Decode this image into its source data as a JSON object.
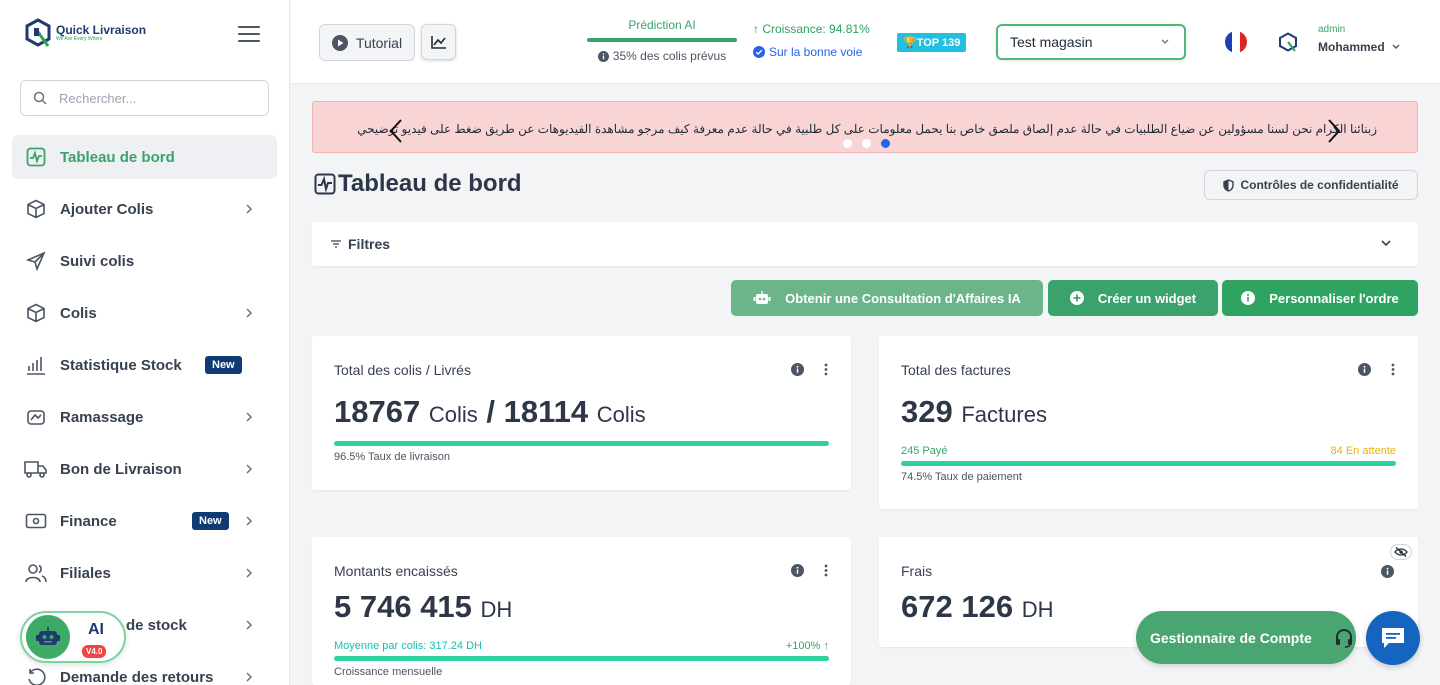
{
  "sidebar": {
    "logo": {
      "name": "Quick Livraison",
      "tagline": "We Are Every Where"
    },
    "search_placeholder": "Rechercher...",
    "items": [
      {
        "label": "Tableau de bord"
      },
      {
        "label": "Ajouter Colis"
      },
      {
        "label": "Suivi colis"
      },
      {
        "label": "Colis"
      },
      {
        "label": "Statistique Stock",
        "badge": "New"
      },
      {
        "label": "Ramassage"
      },
      {
        "label": "Bon de Livraison"
      },
      {
        "label": "Finance",
        "badge": "New"
      },
      {
        "label": "Filiales"
      },
      {
        "label": "de stock"
      },
      {
        "label": "Demande des retours"
      }
    ],
    "ai": {
      "label": "AI",
      "version": "V4.0"
    }
  },
  "topbar": {
    "tutorial_label": "Tutorial",
    "prediction": {
      "title": "Prédiction AI",
      "subtitle": "35% des colis prévus",
      "progress_percent": 100
    },
    "growth": {
      "label": "Croissance: 94.81%",
      "status": "Sur la bonne voie"
    },
    "top_badge": "🏆TOP 139",
    "store_select": "Test magasin",
    "user": {
      "role": "admin",
      "name": "Mohammed"
    },
    "colors": {
      "accent": "#3aa36b",
      "brand": "#1e3a6e"
    }
  },
  "banner": {
    "text": "زبنائنا الكرام نحن لسنا مسؤولين عن ضياع الطلبيات في حالة عدم إلصاق ملصق خاص بنا يحمل معلومات على كل طلبية في حالة عدم معرفة كيف مرجو مشاهدة الفيديوهات عن طريق ضغط على فيديو توضيحي وشكرا على تفهمكم",
    "active_slide": 3,
    "slides": 3
  },
  "page": {
    "title": "Tableau de bord",
    "privacy_label": "Contrôles de confidentialité",
    "filters_label": "Filtres"
  },
  "actions": {
    "consult": "Obtenir une Consultation d'Affaires IA",
    "widget": "Créer un widget",
    "order": "Personnaliser l'ordre"
  },
  "cards": {
    "colis": {
      "title": "Total des colis / Livrés",
      "total": "18767",
      "unit1": "Colis",
      "sep": "/",
      "delivered": "18114",
      "unit2": "Colis",
      "rate_label": "96.5% Taux de livraison",
      "rate": 96.5
    },
    "factures": {
      "title": "Total des factures",
      "total": "329",
      "unit": "Factures",
      "paid": "245 Payé",
      "pending": "84 En attente",
      "rate_label": "74.5% Taux de paiement"
    },
    "montants": {
      "title": "Montants encaissés",
      "value": "5 746 415",
      "unit": "DH",
      "avg": "Moyenne par colis: 317.24 DH",
      "growth": "+100% ↑",
      "sub": "Croissance mensuelle"
    },
    "frais": {
      "title": "Frais",
      "value": "672 126",
      "unit": "DH"
    }
  },
  "floating": {
    "account_manager": "Gestionnaire de Compte"
  }
}
